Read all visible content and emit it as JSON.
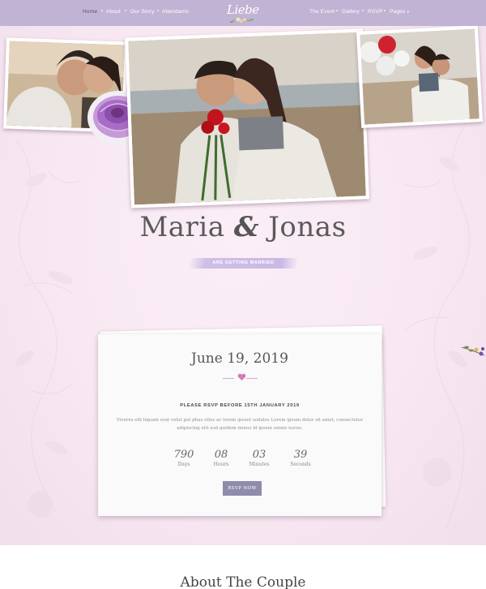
{
  "nav": {
    "left_items": [
      {
        "label": "Home"
      },
      {
        "label": "About"
      },
      {
        "label": "Our Story"
      },
      {
        "label": "Attendants"
      }
    ],
    "right_items": [
      {
        "label": "The Event"
      },
      {
        "label": "Gallery"
      },
      {
        "label": "RSVP"
      },
      {
        "label": "Pages"
      }
    ],
    "logo_text": "Liebe",
    "bg_color": "#c0b3d3"
  },
  "hero": {
    "name_left": "Maria",
    "ampersand": "&",
    "name_right": "Jonas",
    "tagline": "ARE GETTING MARRIED"
  },
  "event_card": {
    "date": "June 19, 2019",
    "rsvp_note": "PLEASE RSVP BEFORE 15TH JANUARY 2019",
    "description": "Viverra elit liquam erat volut pat phas ellus ac lorem ipsuet sodales Lorem ipsum dolor sit amet, consectetur adipiscing elit usd quidem minus id ipsum omnis nerus.",
    "countdown": [
      {
        "value": "790",
        "label": "Days"
      },
      {
        "value": "08",
        "label": "Hours"
      },
      {
        "value": "03",
        "label": "Minutes"
      },
      {
        "value": "39",
        "label": "Seconds"
      }
    ],
    "button_label": "RSVP NOW"
  },
  "about": {
    "title": "About The Couple"
  },
  "colors": {
    "accent": "#c0b3d3",
    "button": "#8f8bad",
    "heart": "#d47ab9"
  }
}
